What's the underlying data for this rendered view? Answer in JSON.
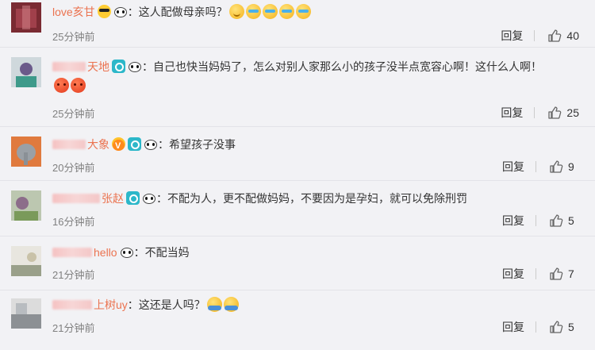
{
  "comments": [
    {
      "user_visible": "love亥甘",
      "text": "：这人配做母亲吗？",
      "time": "25分钟前",
      "reply_label": "回复",
      "likes": "40"
    },
    {
      "user_visible": "天地",
      "text": "：自己也快当妈妈了，怎么对别人家那么小的孩子没半点宽容心啊！这什么人啊！",
      "time": "25分钟前",
      "reply_label": "回复",
      "likes": "25"
    },
    {
      "user_visible": "大象",
      "text": "：希望孩子没事",
      "time": "20分钟前",
      "reply_label": "回复",
      "likes": "9"
    },
    {
      "user_visible": "张赵",
      "text": "：不配为人，更不配做妈妈，不要因为是孕妇，就可以免除刑罚",
      "time": "16分钟前",
      "reply_label": "回复",
      "likes": "5"
    },
    {
      "user_visible": "hello",
      "text": "：不配当妈",
      "time": "21分钟前",
      "reply_label": "回复",
      "likes": "7"
    },
    {
      "user_visible": "上树uy",
      "text": "：这还是人吗？",
      "time": "21分钟前",
      "reply_label": "回复",
      "likes": "5"
    }
  ],
  "colors": {
    "username": "#eb7350",
    "time": "#808080",
    "background": "#f2f2f5"
  },
  "icons": {
    "like": "thumbs-up-icon",
    "camera_badge": "camera-badge-icon",
    "panda": "panda-emoji-icon"
  }
}
